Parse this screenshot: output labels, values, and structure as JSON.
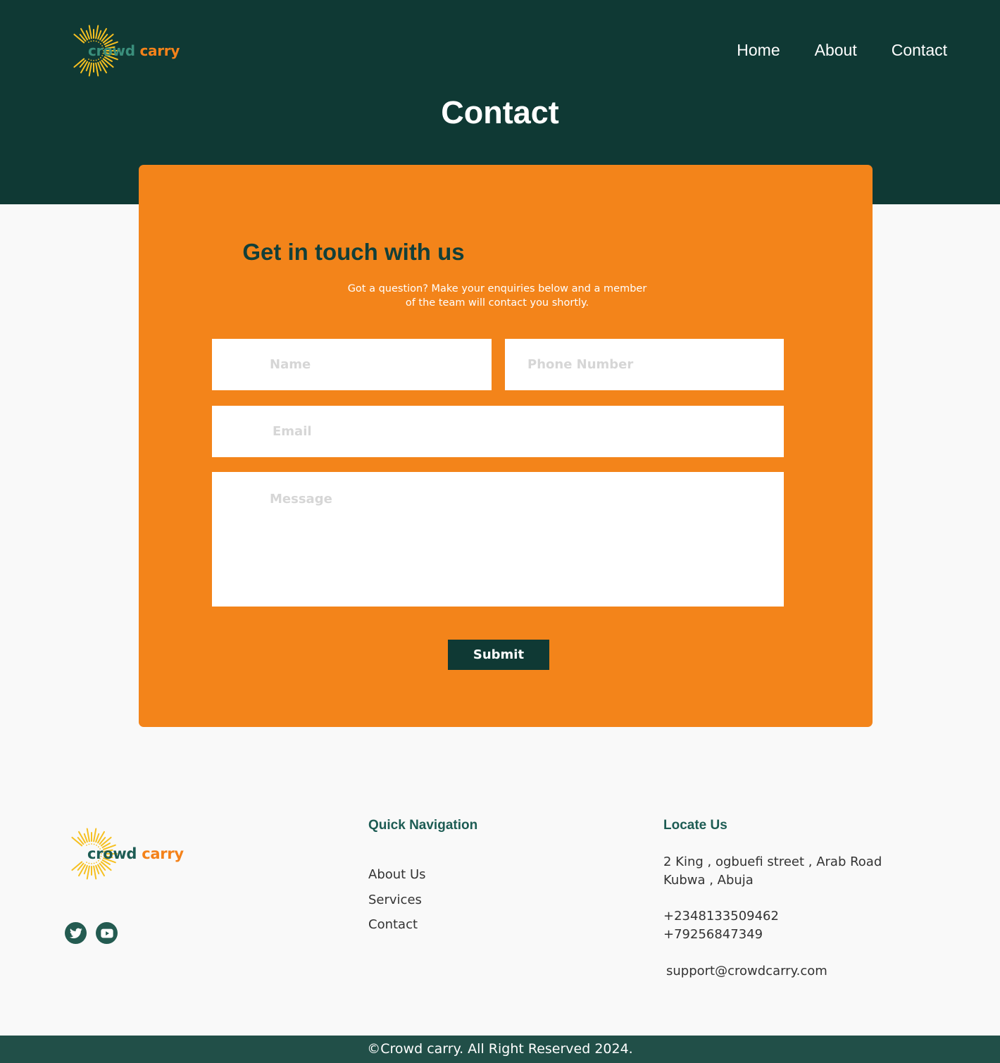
{
  "brand": {
    "word1": "crowd",
    "word2": "carry",
    "logo_icon": "sunburst-icon"
  },
  "nav": {
    "items": [
      {
        "label": "Home"
      },
      {
        "label": "About"
      },
      {
        "label": "Contact"
      }
    ]
  },
  "hero": {
    "title": "Contact"
  },
  "form": {
    "title": "Get in touch with us",
    "subtitle_line1": "Got a question? Make your enquiries below and a member",
    "subtitle_line2": "of the team will contact you shortly.",
    "name_placeholder": "Name",
    "phone_placeholder": "Phone Number",
    "email_placeholder": "Email",
    "message_placeholder": "Message",
    "submit_label": "Submit"
  },
  "footer": {
    "social_icons": [
      "twitter-icon",
      "youtube-icon"
    ],
    "quick_nav": {
      "title": "Quick Navigation",
      "items": [
        {
          "label": "About Us"
        },
        {
          "label": "Services"
        },
        {
          "label": "Contact"
        }
      ]
    },
    "locate": {
      "title": "Locate Us",
      "address_line1": "2 King , ogbuefi street , Arab Road",
      "address_line2": "Kubwa , Abuja",
      "phone1": "+2348133509462",
      "phone2": "+79256847349",
      "email": "support@crowdcarry.com"
    },
    "copyright": "©Crowd carry. All Right Reserved 2024."
  },
  "colors": {
    "header_bg": "#0f3934",
    "accent_orange": "#f3841a",
    "dark_green": "#123f39",
    "teal": "#1d5c54",
    "page_bg": "#f9f9f9",
    "bottom_bar": "#214f48",
    "logo_yellow": "#f6c021"
  }
}
